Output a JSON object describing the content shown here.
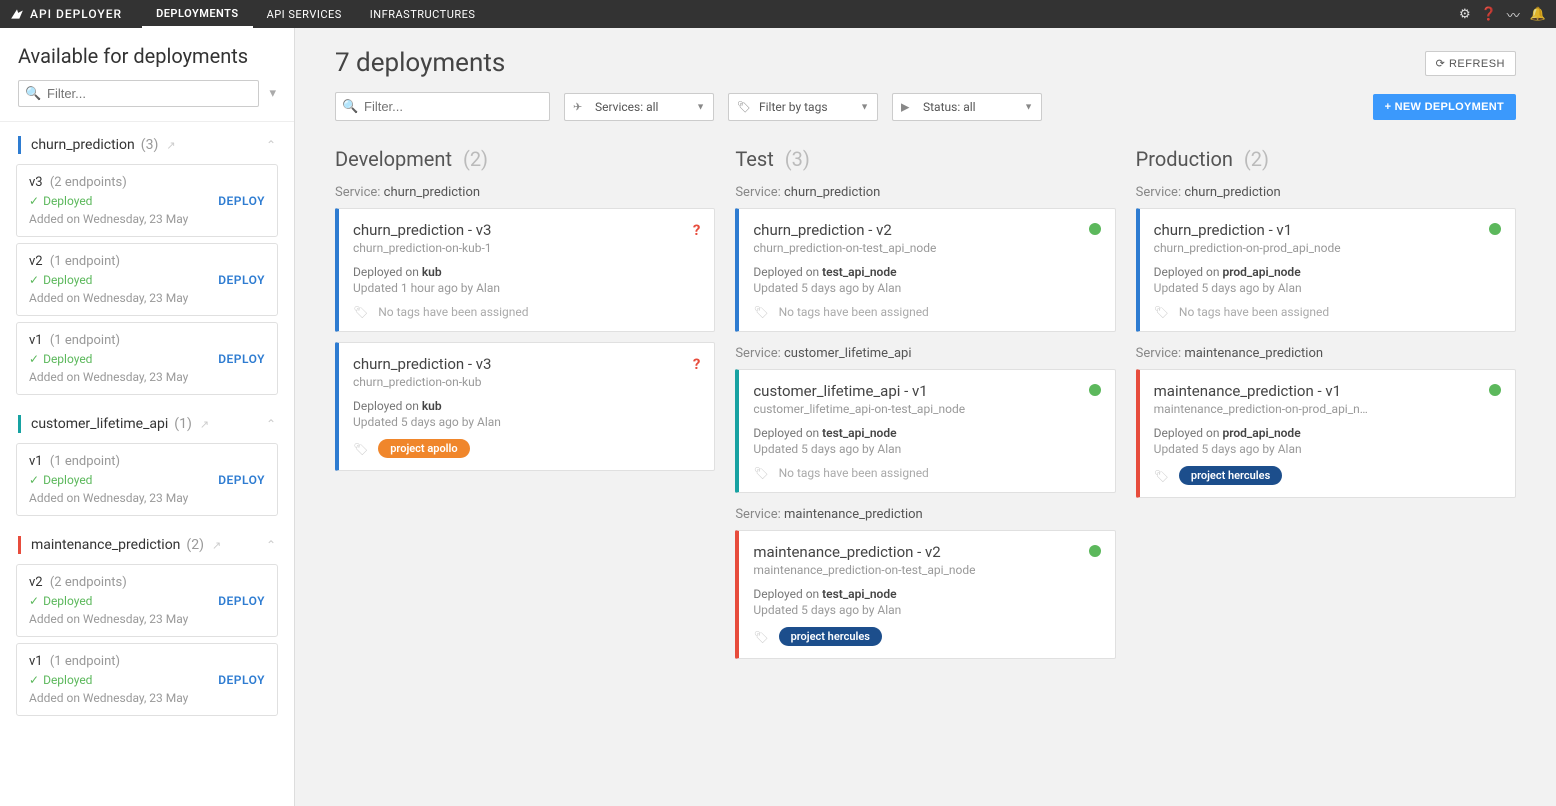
{
  "topbar": {
    "brand": "API DEPLOYER",
    "nav": [
      "DEPLOYMENTS",
      "API SERVICES",
      "INFRASTRUCTURES"
    ],
    "active": 0
  },
  "sidebar": {
    "title": "Available for deployments",
    "filter_placeholder": "Filter...",
    "groups": [
      {
        "name": "churn_prediction",
        "count": "(3)",
        "barClass": "bar-blue",
        "versions": [
          {
            "ver": "v3",
            "ep": "(2 endpoints)",
            "status": "Deployed",
            "added": "Added on Wednesday, 23 May",
            "deploy": "DEPLOY"
          },
          {
            "ver": "v2",
            "ep": "(1 endpoint)",
            "status": "Deployed",
            "added": "Added on Wednesday, 23 May",
            "deploy": "DEPLOY"
          },
          {
            "ver": "v1",
            "ep": "(1 endpoint)",
            "status": "Deployed",
            "added": "Added on Wednesday, 23 May",
            "deploy": "DEPLOY"
          }
        ]
      },
      {
        "name": "customer_lifetime_api",
        "count": "(1)",
        "barClass": "bar-teal",
        "versions": [
          {
            "ver": "v1",
            "ep": "(1 endpoint)",
            "status": "Deployed",
            "added": "Added on Wednesday, 23 May",
            "deploy": "DEPLOY"
          }
        ]
      },
      {
        "name": "maintenance_prediction",
        "count": "(2)",
        "barClass": "bar-red",
        "versions": [
          {
            "ver": "v2",
            "ep": "(2 endpoints)",
            "status": "Deployed",
            "added": "Added on Wednesday, 23 May",
            "deploy": "DEPLOY"
          },
          {
            "ver": "v1",
            "ep": "(1 endpoint)",
            "status": "Deployed",
            "added": "Added on Wednesday, 23 May",
            "deploy": "DEPLOY"
          }
        ]
      }
    ]
  },
  "main": {
    "title": "7 deployments",
    "refresh": "REFRESH",
    "filter_placeholder": "Filter...",
    "dd_services": "Services: all",
    "dd_tags": "Filter by tags",
    "dd_status": "Status: all",
    "new_deploy": "+ NEW DEPLOYMENT",
    "svc_prefix": "Service: ",
    "no_tags": "No tags have been assigned",
    "dep_prefix": "Deployed on ",
    "columns": [
      {
        "title": "Development",
        "count": "(2)",
        "groups": [
          {
            "service": "churn_prediction",
            "cards": [
              {
                "title": "churn_prediction - v3",
                "sub": "churn_prediction-on-kub-1",
                "node": "kub",
                "updated": "Updated 1 hour ago by Alan",
                "status": "q",
                "border": "bl-blue",
                "tags": []
              },
              {
                "title": "churn_prediction - v3",
                "sub": "churn_prediction-on-kub",
                "node": "kub",
                "updated": "Updated 5 days ago by Alan",
                "status": "q",
                "border": "bl-blue",
                "tags": [
                  {
                    "text": "project apollo",
                    "cls": "tag-orange"
                  }
                ]
              }
            ]
          }
        ]
      },
      {
        "title": "Test",
        "count": "(3)",
        "groups": [
          {
            "service": "churn_prediction",
            "cards": [
              {
                "title": "churn_prediction - v2",
                "sub": "churn_prediction-on-test_api_node",
                "node": "test_api_node",
                "updated": "Updated 5 days ago by Alan",
                "status": "ok",
                "border": "bl-blue",
                "tags": []
              }
            ]
          },
          {
            "service": "customer_lifetime_api",
            "cards": [
              {
                "title": "customer_lifetime_api - v1",
                "sub": "customer_lifetime_api-on-test_api_node",
                "node": "test_api_node",
                "updated": "Updated 5 days ago by Alan",
                "status": "ok",
                "border": "bl-teal",
                "tags": []
              }
            ]
          },
          {
            "service": "maintenance_prediction",
            "cards": [
              {
                "title": "maintenance_prediction - v2",
                "sub": "maintenance_prediction-on-test_api_node",
                "node": "test_api_node",
                "updated": "Updated 5 days ago by Alan",
                "status": "ok",
                "border": "bl-red",
                "tags": [
                  {
                    "text": "project hercules",
                    "cls": "tag-navy"
                  }
                ]
              }
            ]
          }
        ]
      },
      {
        "title": "Production",
        "count": "(2)",
        "groups": [
          {
            "service": "churn_prediction",
            "cards": [
              {
                "title": "churn_prediction - v1",
                "sub": "churn_prediction-on-prod_api_node",
                "node": "prod_api_node",
                "updated": "Updated 5 days ago by Alan",
                "status": "ok",
                "border": "bl-blue",
                "tags": []
              }
            ]
          },
          {
            "service": "maintenance_prediction",
            "cards": [
              {
                "title": "maintenance_prediction - v1",
                "sub": "maintenance_prediction-on-prod_api_n…",
                "node": "prod_api_node",
                "updated": "Updated 5 days ago by Alan",
                "status": "ok",
                "border": "bl-red",
                "tags": [
                  {
                    "text": "project hercules",
                    "cls": "tag-navy"
                  }
                ]
              }
            ]
          }
        ]
      }
    ]
  }
}
